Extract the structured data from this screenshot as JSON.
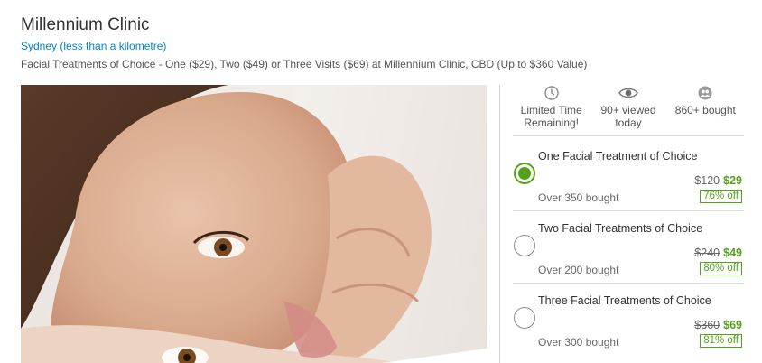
{
  "deal": {
    "title": "Millennium Clinic",
    "location": "Sydney (less than a kilometre)",
    "subtitle": "Facial Treatments of Choice - One ($29), Two ($49) or Three Visits ($69) at Millennium Clinic, CBD (Up to $360 Value)"
  },
  "stats": [
    {
      "icon": "clock-icon",
      "line1": "Limited Time",
      "line2": "Remaining!"
    },
    {
      "icon": "eye-icon",
      "line1": "90+ viewed",
      "line2": "today"
    },
    {
      "icon": "people-icon",
      "line1": "860+ bought",
      "line2": ""
    }
  ],
  "options": [
    {
      "title": "One Facial Treatment of Choice",
      "old_price": "$120",
      "new_price": "$29",
      "discount": "76% off",
      "bought": "Over 350 bought",
      "selected": true
    },
    {
      "title": "Two Facial Treatments of Choice",
      "old_price": "$240",
      "new_price": "$49",
      "discount": "80% off",
      "bought": "Over 200 bought",
      "selected": false
    },
    {
      "title": "Three Facial Treatments of Choice",
      "old_price": "$360",
      "new_price": "$69",
      "discount": "81% off",
      "bought": "Over 300 bought",
      "selected": false
    }
  ],
  "colors": {
    "accent_green": "#53a318",
    "link_blue": "#0185c6"
  }
}
